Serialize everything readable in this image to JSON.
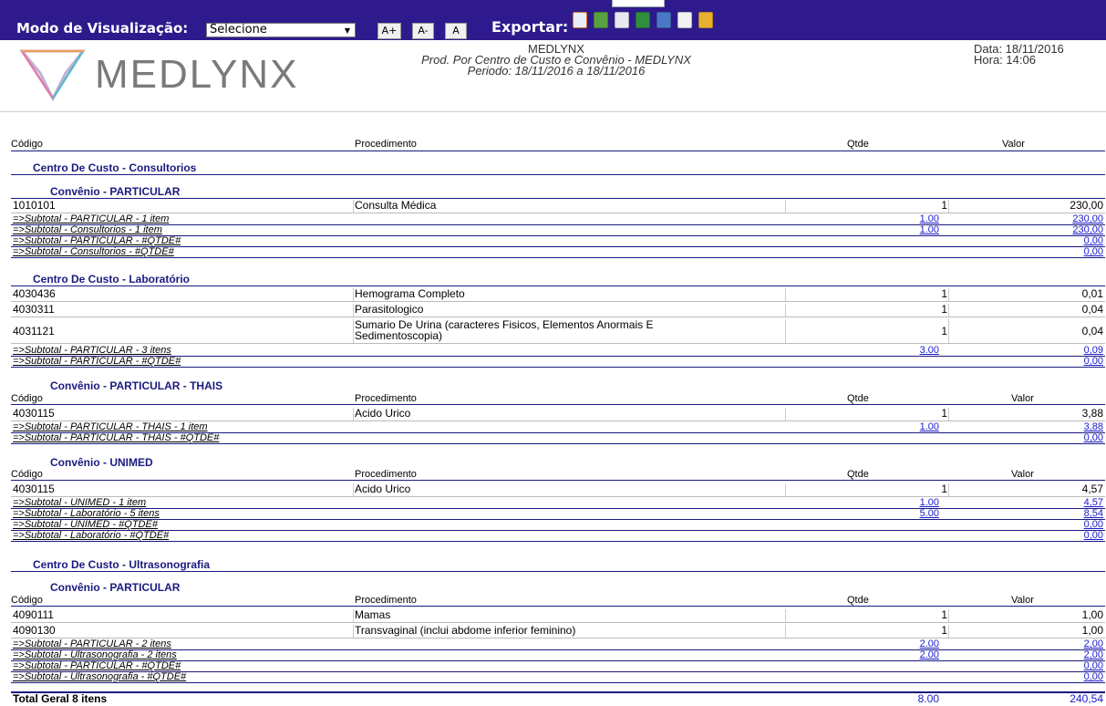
{
  "toolbar": {
    "view_mode_label": "Modo de Visualização:",
    "view_mode_value": "Selecione",
    "font_increase": "A+",
    "font_decrease": "A-",
    "font_reset": "A",
    "export_label": "Exportar:",
    "export_icons": [
      "pdf-icon",
      "print-icon",
      "document-icon",
      "excel-icon",
      "word-icon",
      "txt-icon",
      "html-icon"
    ]
  },
  "header": {
    "logo_text": "MEDLYNX",
    "company": "MEDLYNX",
    "report_title": "Prod. Por Centro de Custo e Convênio - MEDLYNX",
    "period": "Periodo: 18/11/2016 a 18/11/2016",
    "date": "Data: 18/11/2016",
    "time": "Hora: 14:06"
  },
  "columns": {
    "code": "Código",
    "procedure": "Procedimento",
    "qty": "Qtde",
    "value": "Valor"
  },
  "groups": {
    "cc_consultorios": "Centro De Custo - Consultorios",
    "conv_particular_1": "Convênio - PARTICULAR",
    "cc_laboratorio": "Centro De Custo - Laboratório",
    "conv_particular_thais": "Convênio - PARTICULAR - THAIS",
    "conv_unimed": "Convênio - UNIMED",
    "cc_ultrasonografia": "Centro De Custo - Ultrasonografia",
    "conv_particular_2": "Convênio - PARTICULAR"
  },
  "rows": [
    {
      "code": "1010101",
      "procedure": "Consulta Médica",
      "qty": "1",
      "value": "230,00"
    },
    {
      "code": "4030436",
      "procedure": "Hemograma Completo",
      "qty": "1",
      "value": "0,01"
    },
    {
      "code": "4030311",
      "procedure": "Parasitologico",
      "qty": "1",
      "value": "0,04"
    },
    {
      "code": "4031121",
      "procedure": "Sumario De Urina (caracteres Fisicos, Elementos Anormais E Sedimentoscopia)",
      "qty": "1",
      "value": "0,04"
    },
    {
      "code": "4030115",
      "procedure": "Acido Urico",
      "qty": "1",
      "value": "3,88"
    },
    {
      "code": "4030115",
      "procedure": "Acido Urico",
      "qty": "1",
      "value": "4,57"
    },
    {
      "code": "4090111",
      "procedure": "Mamas",
      "qty": "1",
      "value": "1,00"
    },
    {
      "code": "4090130",
      "procedure": "Transvaginal (inclui abdome inferior feminino)",
      "qty": "1",
      "value": "1,00"
    }
  ],
  "subtotals": [
    {
      "label": "=>Subtotal - PARTICULAR - 1 item",
      "qty": "1.00",
      "value": "230,00"
    },
    {
      "label": "=>Subtotal - Consultorios - 1 item",
      "qty": "1.00",
      "value": "230,00"
    },
    {
      "label": "=>Subtotal - PARTICULAR - #QTDE#",
      "qty": "",
      "value": "0,00"
    },
    {
      "label": "=>Subtotal - Consultorios - #QTDE#",
      "qty": "",
      "value": "0,00"
    },
    {
      "label": "=>Subtotal - PARTICULAR - 3 itens",
      "qty": "3.00",
      "value": "0,09"
    },
    {
      "label": "=>Subtotal - PARTICULAR - #QTDE#",
      "qty": "",
      "value": "0,00"
    },
    {
      "label": "=>Subtotal - PARTICULAR - THAIS - 1 item",
      "qty": "1.00",
      "value": "3,88"
    },
    {
      "label": "=>Subtotal - PARTICULAR - THAIS - #QTDE#",
      "qty": "",
      "value": "0,00"
    },
    {
      "label": "=>Subtotal - UNIMED - 1 item",
      "qty": "1.00",
      "value": "4,57"
    },
    {
      "label": "=>Subtotal - Laboratório - 5 itens",
      "qty": "5.00",
      "value": "8,54"
    },
    {
      "label": "=>Subtotal - UNIMED - #QTDE#",
      "qty": "",
      "value": "0,00"
    },
    {
      "label": "=>Subtotal - Laboratório - #QTDE#",
      "qty": "",
      "value": "0,00"
    },
    {
      "label": "=>Subtotal - PARTICULAR - 2 itens",
      "qty": "2.00",
      "value": "2,00"
    },
    {
      "label": "=>Subtotal - Ultrasonografia - 2 itens",
      "qty": "2.00",
      "value": "2,00"
    },
    {
      "label": "=>Subtotal - PARTICULAR - #QTDE#",
      "qty": "",
      "value": "0,00"
    },
    {
      "label": "=>Subtotal - Ultrasonografia - #QTDE#",
      "qty": "",
      "value": "0,00"
    }
  ],
  "total": {
    "label": "Total Geral 8 itens",
    "qty": "8.00",
    "value": "240,54"
  },
  "colors": {
    "toolbar_bg": "#2e1a8c",
    "group_text": "#1a1a80",
    "subtotal_link": "#1a1acc"
  }
}
